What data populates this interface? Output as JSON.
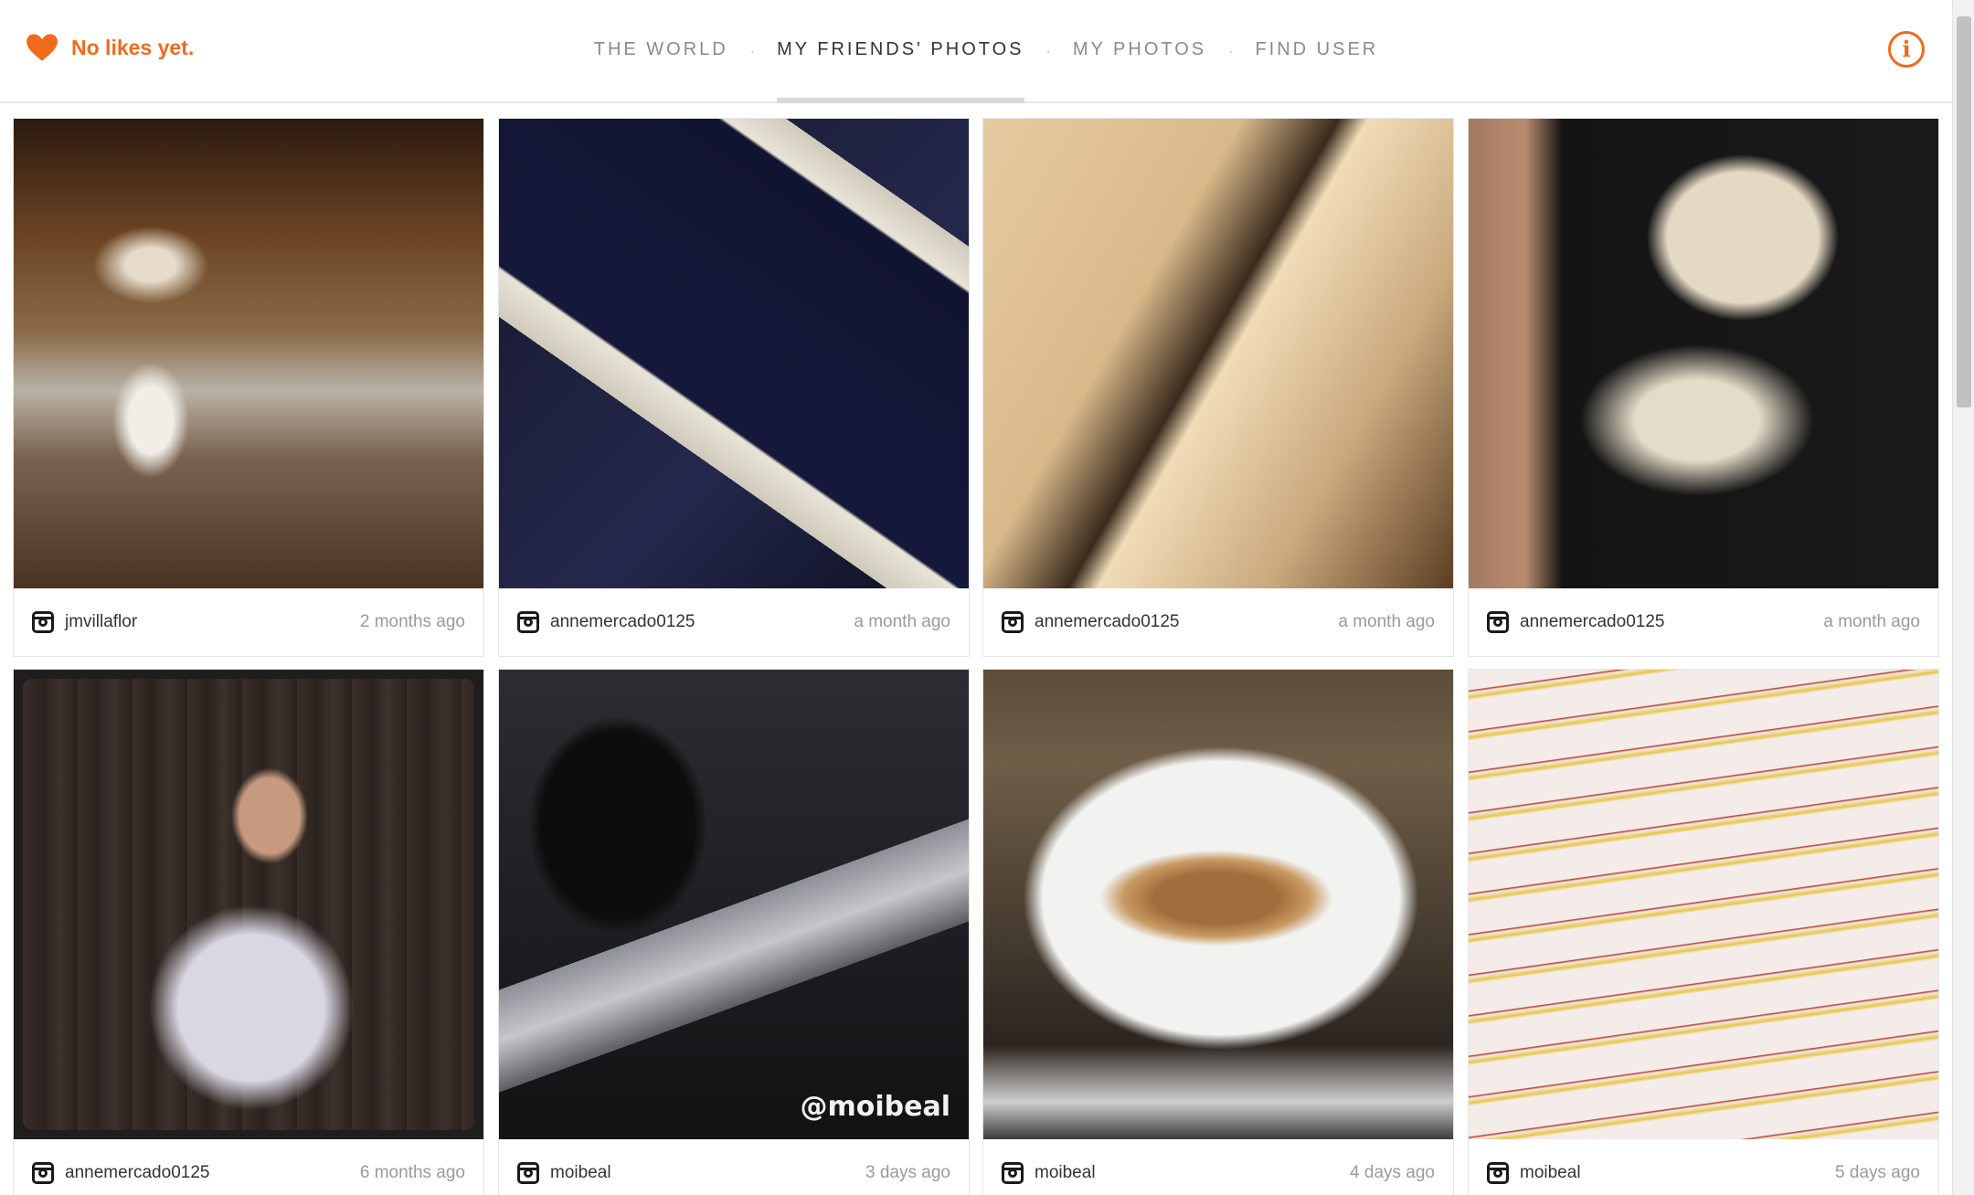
{
  "header": {
    "likes_text": "No likes yet.",
    "nav": [
      {
        "label": "THE WORLD",
        "active": false
      },
      {
        "label": "MY FRIENDS' PHOTOS",
        "active": true
      },
      {
        "label": "MY PHOTOS",
        "active": false
      },
      {
        "label": "FIND USER",
        "active": false
      }
    ],
    "separator": "·",
    "info_symbol": "i"
  },
  "accent_color": "#f26a1b",
  "photos": [
    {
      "user": "jmvillaflor",
      "time": "2 months ago"
    },
    {
      "user": "annemercado0125",
      "time": "a month ago"
    },
    {
      "user": "annemercado0125",
      "time": "a month ago"
    },
    {
      "user": "annemercado0125",
      "time": "a month ago"
    },
    {
      "user": "annemercado0125",
      "time": "6 months ago"
    },
    {
      "user": "moibeal",
      "time": "3 days ago",
      "watermark": "@moibeal"
    },
    {
      "user": "moibeal",
      "time": "4 days ago"
    },
    {
      "user": "moibeal",
      "time": "5 days ago"
    }
  ]
}
